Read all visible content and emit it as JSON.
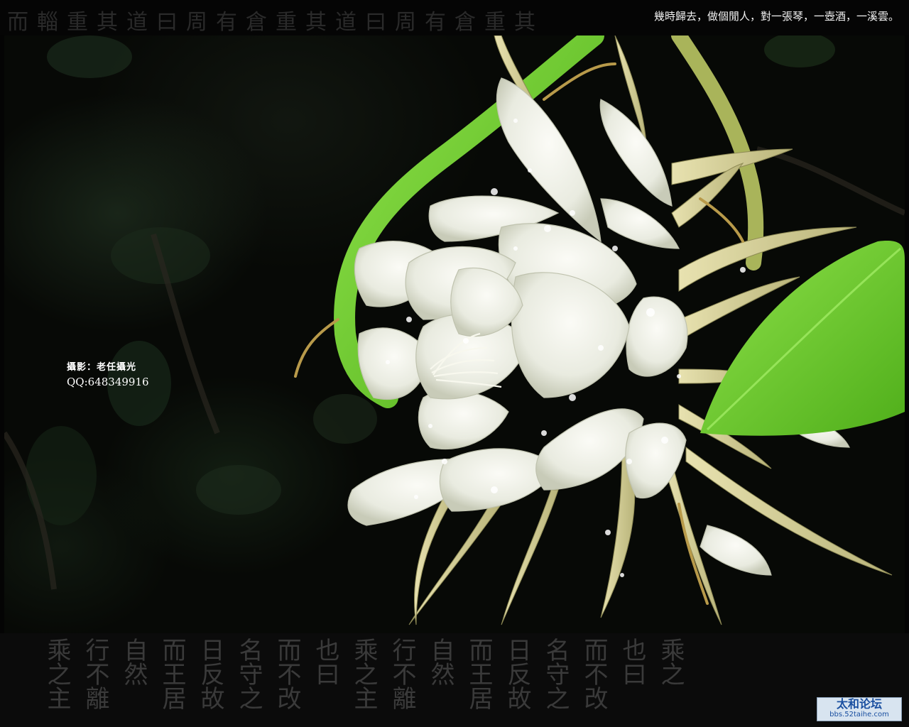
{
  "poem": "幾時歸去，做個閒人，對一張琴，一壺酒，一溪雲。",
  "top_calligraphy": "而輜重其道曰周有倉重其道曰周有倉重其",
  "credit": {
    "line1": "攝影：老任攝光",
    "line2": "QQ:648349916"
  },
  "bottom_calligraphy": [
    "乘之主",
    "行不離",
    "自然",
    "而王居",
    "日反故",
    "名守之",
    "而不改",
    "也曰",
    "乘之主",
    "行不離",
    "自然",
    "而王居",
    "日反故",
    "名守之",
    "而不改",
    "也曰",
    "乘之"
  ],
  "watermark": {
    "title": "太和论坛",
    "url": "bbs.52taihe.com"
  },
  "colors": {
    "petal": "#f4f4ee",
    "stem": "#9ccc4a",
    "leaf": "#6ecc2a",
    "background": "#070906"
  }
}
